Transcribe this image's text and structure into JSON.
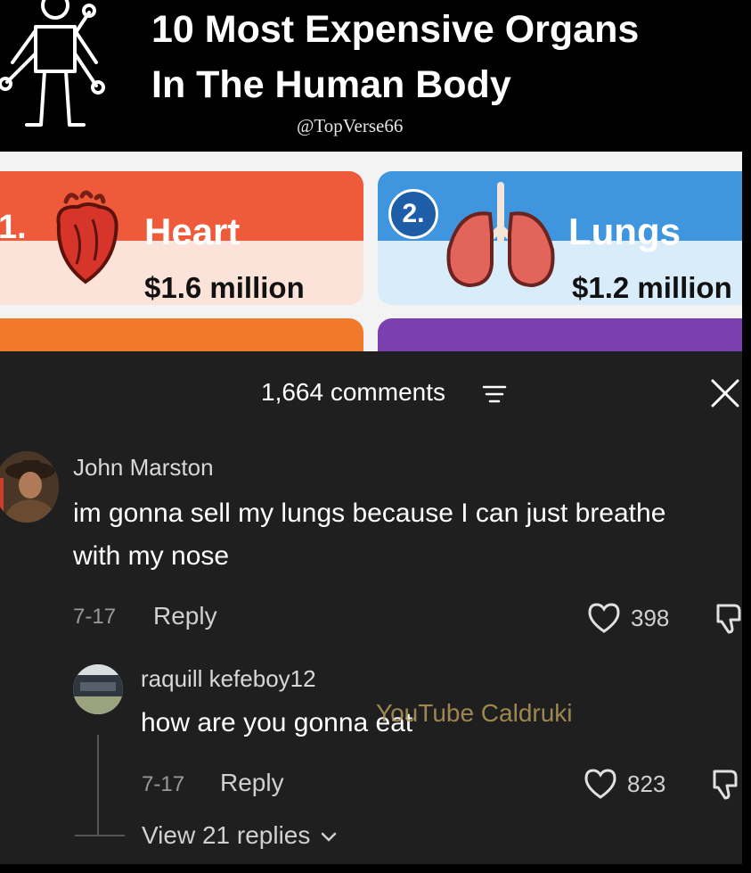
{
  "video": {
    "title_line1": "10 Most Expensive Organs",
    "title_line2": "In The Human Body",
    "handle": "@TopVerse66",
    "cards": [
      {
        "rank": "1.",
        "name": "Heart",
        "price": "$1.6 million",
        "icon": "heart-organ-icon",
        "color": "#ee5a3a"
      },
      {
        "rank": "2.",
        "name": "Lungs",
        "price": "$1.2 million",
        "icon": "lungs-icon",
        "color": "#3f96de"
      }
    ]
  },
  "comments_panel": {
    "count_label": "1,664 comments",
    "comments": [
      {
        "username": "John Marston",
        "text": "im gonna sell my lungs because I can just breathe with my nose",
        "date": "7-17",
        "reply_label": "Reply",
        "likes": "398"
      },
      {
        "username": "raquill kefeboy12",
        "text": "how are you gonna eat",
        "date": "7-17",
        "reply_label": "Reply",
        "likes": "823"
      }
    ],
    "view_replies_label": "View 21 replies"
  },
  "watermark": "YouTube Caldruki",
  "colors": {
    "panel_bg": "#1f1f1f",
    "heart_card": "#ee5a3a",
    "lungs_card": "#3f96de"
  }
}
